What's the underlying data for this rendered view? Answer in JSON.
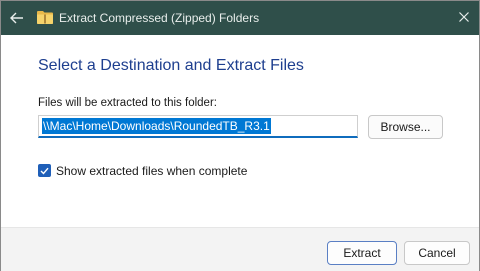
{
  "window": {
    "title": "Extract Compressed (Zipped) Folders",
    "back_icon": "arrow-left-icon",
    "folder_icon": "zip-folder-icon",
    "close_icon": "close-icon"
  },
  "main": {
    "heading": "Select a Destination and Extract Files",
    "path_label": "Files will be extracted to this folder:",
    "path_value": "\\\\Mac\\Home\\Downloads\\RoundedTB_R3.1",
    "browse_label": "Browse...",
    "show_files_checked": true,
    "show_files_label": "Show extracted files when complete"
  },
  "footer": {
    "extract_label": "Extract",
    "cancel_label": "Cancel"
  },
  "colors": {
    "titlebar": "#2f4f4a",
    "heading": "#1e3f8f",
    "accent": "#0078d4"
  }
}
